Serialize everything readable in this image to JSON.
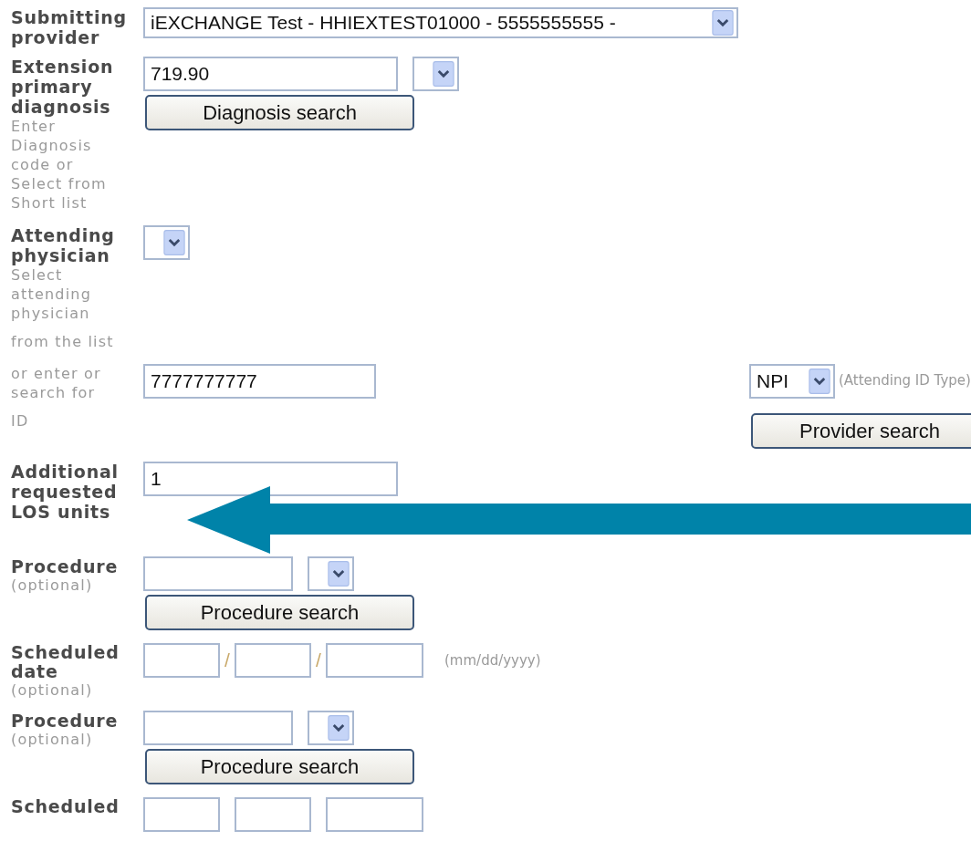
{
  "rows": [
    {
      "kind": "provider",
      "label": "Submitting provider",
      "value": "iEXCHANGE Test - HHIEXTEST01000 - 5555555555 -"
    },
    {
      "kind": "code",
      "label": "Extension primary diagnosis",
      "help": "Enter Diagnosis code or Select from Short list",
      "value": "719.90",
      "button": "Diagnosis search"
    },
    {
      "kind": "physician",
      "label": "Attending physician",
      "help": "Select attending physician",
      "help_2": "from the list",
      "help_3": "or enter or search for",
      "help_4": "ID",
      "value": "7777777777",
      "id_type": "NPI",
      "id_type_note": "(Attending ID Type)",
      "button": "Provider search"
    },
    {
      "kind": "units",
      "label": "Additional requested LOS units",
      "value": "1"
    },
    {
      "kind": "code",
      "label": "Procedure",
      "note": "(optional)",
      "button": "Procedure search"
    },
    {
      "kind": "date",
      "label": "Scheduled date",
      "note": "(optional)",
      "separators": [
        "/",
        "/"
      ],
      "format": "(mm/dd/yyyy)"
    },
    {
      "kind": "code",
      "label": "Procedure",
      "note": "(optional)",
      "button": "Procedure search"
    },
    {
      "kind": "date",
      "label": "Scheduled"
    }
  ]
}
